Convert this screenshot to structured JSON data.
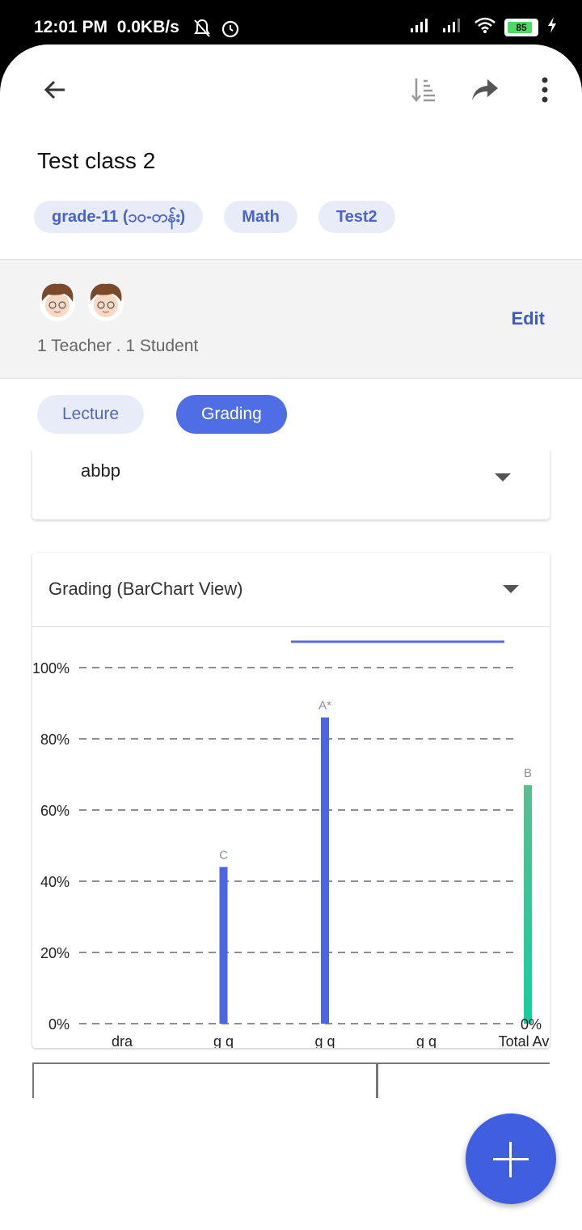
{
  "status": {
    "time": "12:01 PM",
    "speed": "0.0KB/s",
    "battery": "85"
  },
  "header": {
    "title": "Test class 2",
    "chips": [
      "grade-11 (၁၀-တန်း)",
      "Math",
      "Test2"
    ]
  },
  "members": {
    "summary": "1 Teacher . 1 Student",
    "edit_label": "Edit"
  },
  "tabs": {
    "lecture": "Lecture",
    "grading": "Grading"
  },
  "filter": {
    "selected": "abbp"
  },
  "chart_card": {
    "selected_view": "Grading (BarChart View)"
  },
  "colors": {
    "accent": "#4f6de4",
    "bar_blue": "#4a66e2",
    "bar_total_top": "#5bbd8f",
    "bar_total_bottom": "#13cf9f"
  },
  "chart_data": {
    "type": "bar",
    "categories": [
      "dra",
      "g q",
      "g q",
      "g q",
      "Total Avg"
    ],
    "values": [
      0,
      44,
      86,
      0,
      67
    ],
    "bar_labels": [
      "",
      "C",
      "A*",
      "",
      "B"
    ],
    "yticks": [
      "0%",
      "20%",
      "40%",
      "60%",
      "80%",
      "100%"
    ],
    "right_axis_label": "0%",
    "ylim": [
      0,
      100
    ],
    "grid": true
  }
}
